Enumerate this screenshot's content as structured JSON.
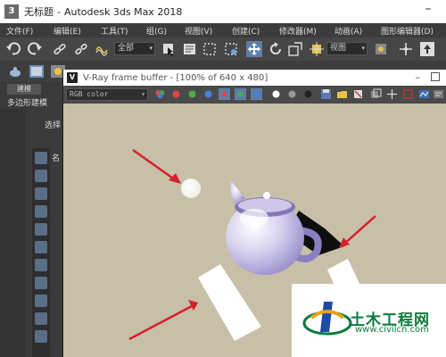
{
  "window": {
    "doc_title": "无标题",
    "separator": "-",
    "app_title": "Autodesk 3ds Max 2018"
  },
  "menu": {
    "items": [
      "文件(F)",
      "编辑(E)",
      "工具(T)",
      "组(G)",
      "视图(V)",
      "创建(C)",
      "修改器(M)",
      "动画(A)",
      "图形编辑器(D)"
    ]
  },
  "toolbar": {
    "selection_filter": "全部",
    "view_dropdown": "视图"
  },
  "ribbon": {
    "button_label": "建模",
    "label": "多边形建模"
  },
  "side_panel": {
    "select_label": "选择",
    "name_label": "名"
  },
  "frame_buffer": {
    "title": "V-Ray frame buffer - [100% of 640 x 480]",
    "channel": "RGB color"
  },
  "watermark": {
    "title": "土木工程网",
    "url": "www.civilcn.com"
  },
  "colors": {
    "render_background": "#c7bfa8",
    "arrow": "#d6202a",
    "watermark_green": "#0b7a3e"
  }
}
